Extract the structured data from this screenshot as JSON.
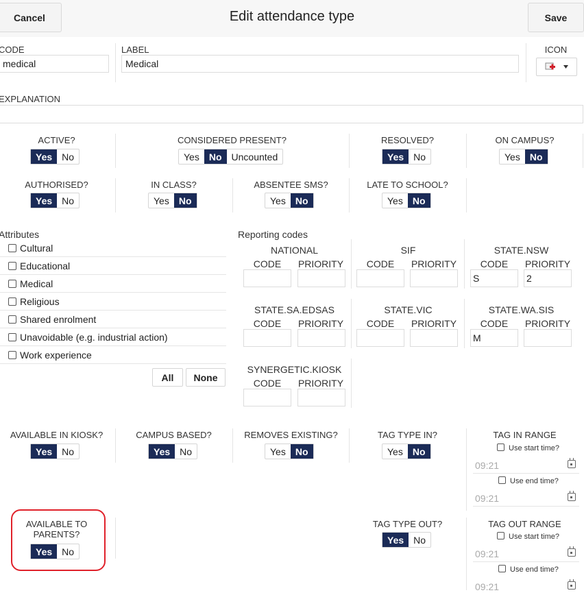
{
  "header": {
    "cancel_label": "Cancel",
    "title": "Edit attendance type",
    "save_label": "Save"
  },
  "fields": {
    "code_label": "CODE",
    "code_value": "medical",
    "label_label": "LABEL",
    "label_value": "Medical",
    "icon_label": "ICON",
    "icon_name": "medical-cross-icon",
    "explanation_label": "EXPLANATION",
    "explanation_value": ""
  },
  "toggles": {
    "active": {
      "label": "ACTIVE?",
      "yes": "Yes",
      "no": "No",
      "value": "Yes"
    },
    "considered_present": {
      "label": "CONSIDERED PRESENT?",
      "yes": "Yes",
      "no": "No",
      "uncounted": "Uncounted",
      "value": "No"
    },
    "resolved": {
      "label": "RESOLVED?",
      "yes": "Yes",
      "no": "No",
      "value": "Yes"
    },
    "on_campus": {
      "label": "ON CAMPUS?",
      "yes": "Yes",
      "no": "No",
      "value": "No"
    },
    "authorised": {
      "label": "AUTHORISED?",
      "yes": "Yes",
      "no": "No",
      "value": "Yes"
    },
    "in_class": {
      "label": "IN CLASS?",
      "yes": "Yes",
      "no": "No",
      "value": "No"
    },
    "absentee_sms": {
      "label": "ABSENTEE SMS?",
      "yes": "Yes",
      "no": "No",
      "value": "No"
    },
    "late_to_school": {
      "label": "LATE TO SCHOOL?",
      "yes": "Yes",
      "no": "No",
      "value": "No"
    },
    "available_in_kiosk": {
      "label": "AVAILABLE IN KIOSK?",
      "yes": "Yes",
      "no": "No",
      "value": "Yes"
    },
    "campus_based": {
      "label": "CAMPUS BASED?",
      "yes": "Yes",
      "no": "No",
      "value": "Yes"
    },
    "removes_existing": {
      "label": "REMOVES EXISTING?",
      "yes": "Yes",
      "no": "No",
      "value": "No"
    },
    "tag_type_in": {
      "label": "TAG TYPE IN?",
      "yes": "Yes",
      "no": "No",
      "value": "No"
    },
    "available_to_parents": {
      "label": "AVAILABLE TO PARENTS?",
      "yes": "Yes",
      "no": "No",
      "value": "Yes"
    },
    "tag_type_out": {
      "label": "TAG TYPE OUT?",
      "yes": "Yes",
      "no": "No",
      "value": "Yes"
    }
  },
  "attributes": {
    "title": "Attributes",
    "items": [
      {
        "label": "Cultural",
        "checked": false
      },
      {
        "label": "Educational",
        "checked": false
      },
      {
        "label": "Medical",
        "checked": false
      },
      {
        "label": "Religious",
        "checked": false
      },
      {
        "label": "Shared enrolment",
        "checked": false
      },
      {
        "label": "Unavoidable (e.g. industrial action)",
        "checked": false
      },
      {
        "label": "Work experience",
        "checked": false
      }
    ],
    "all_label": "All",
    "none_label": "None"
  },
  "reporting": {
    "title": "Reporting codes",
    "code_header": "CODE",
    "priority_header": "PRIORITY",
    "groups": [
      {
        "name": "NATIONAL",
        "code": "",
        "priority": ""
      },
      {
        "name": "SIF",
        "code": "",
        "priority": ""
      },
      {
        "name": "STATE.NSW",
        "code": "S",
        "priority": "2"
      },
      {
        "name": "STATE.SA.EDSAS",
        "code": "",
        "priority": ""
      },
      {
        "name": "STATE.VIC",
        "code": "",
        "priority": ""
      },
      {
        "name": "STATE.WA.SIS",
        "code": "M",
        "priority": ""
      },
      {
        "name": "SYNERGETIC.KIOSK",
        "code": "",
        "priority": ""
      }
    ]
  },
  "tag_in_range": {
    "label": "TAG IN RANGE",
    "use_start_label": "Use start time?",
    "start_time": "09:21",
    "use_end_label": "Use end time?",
    "end_time": "09:21"
  },
  "tag_out_range": {
    "label": "TAG OUT RANGE",
    "use_start_label": "Use start time?",
    "start_time": "09:21",
    "use_end_label": "Use end time?",
    "end_time": "09:21"
  },
  "colors": {
    "accent": "#1b2b57",
    "highlight": "#e0212a"
  }
}
